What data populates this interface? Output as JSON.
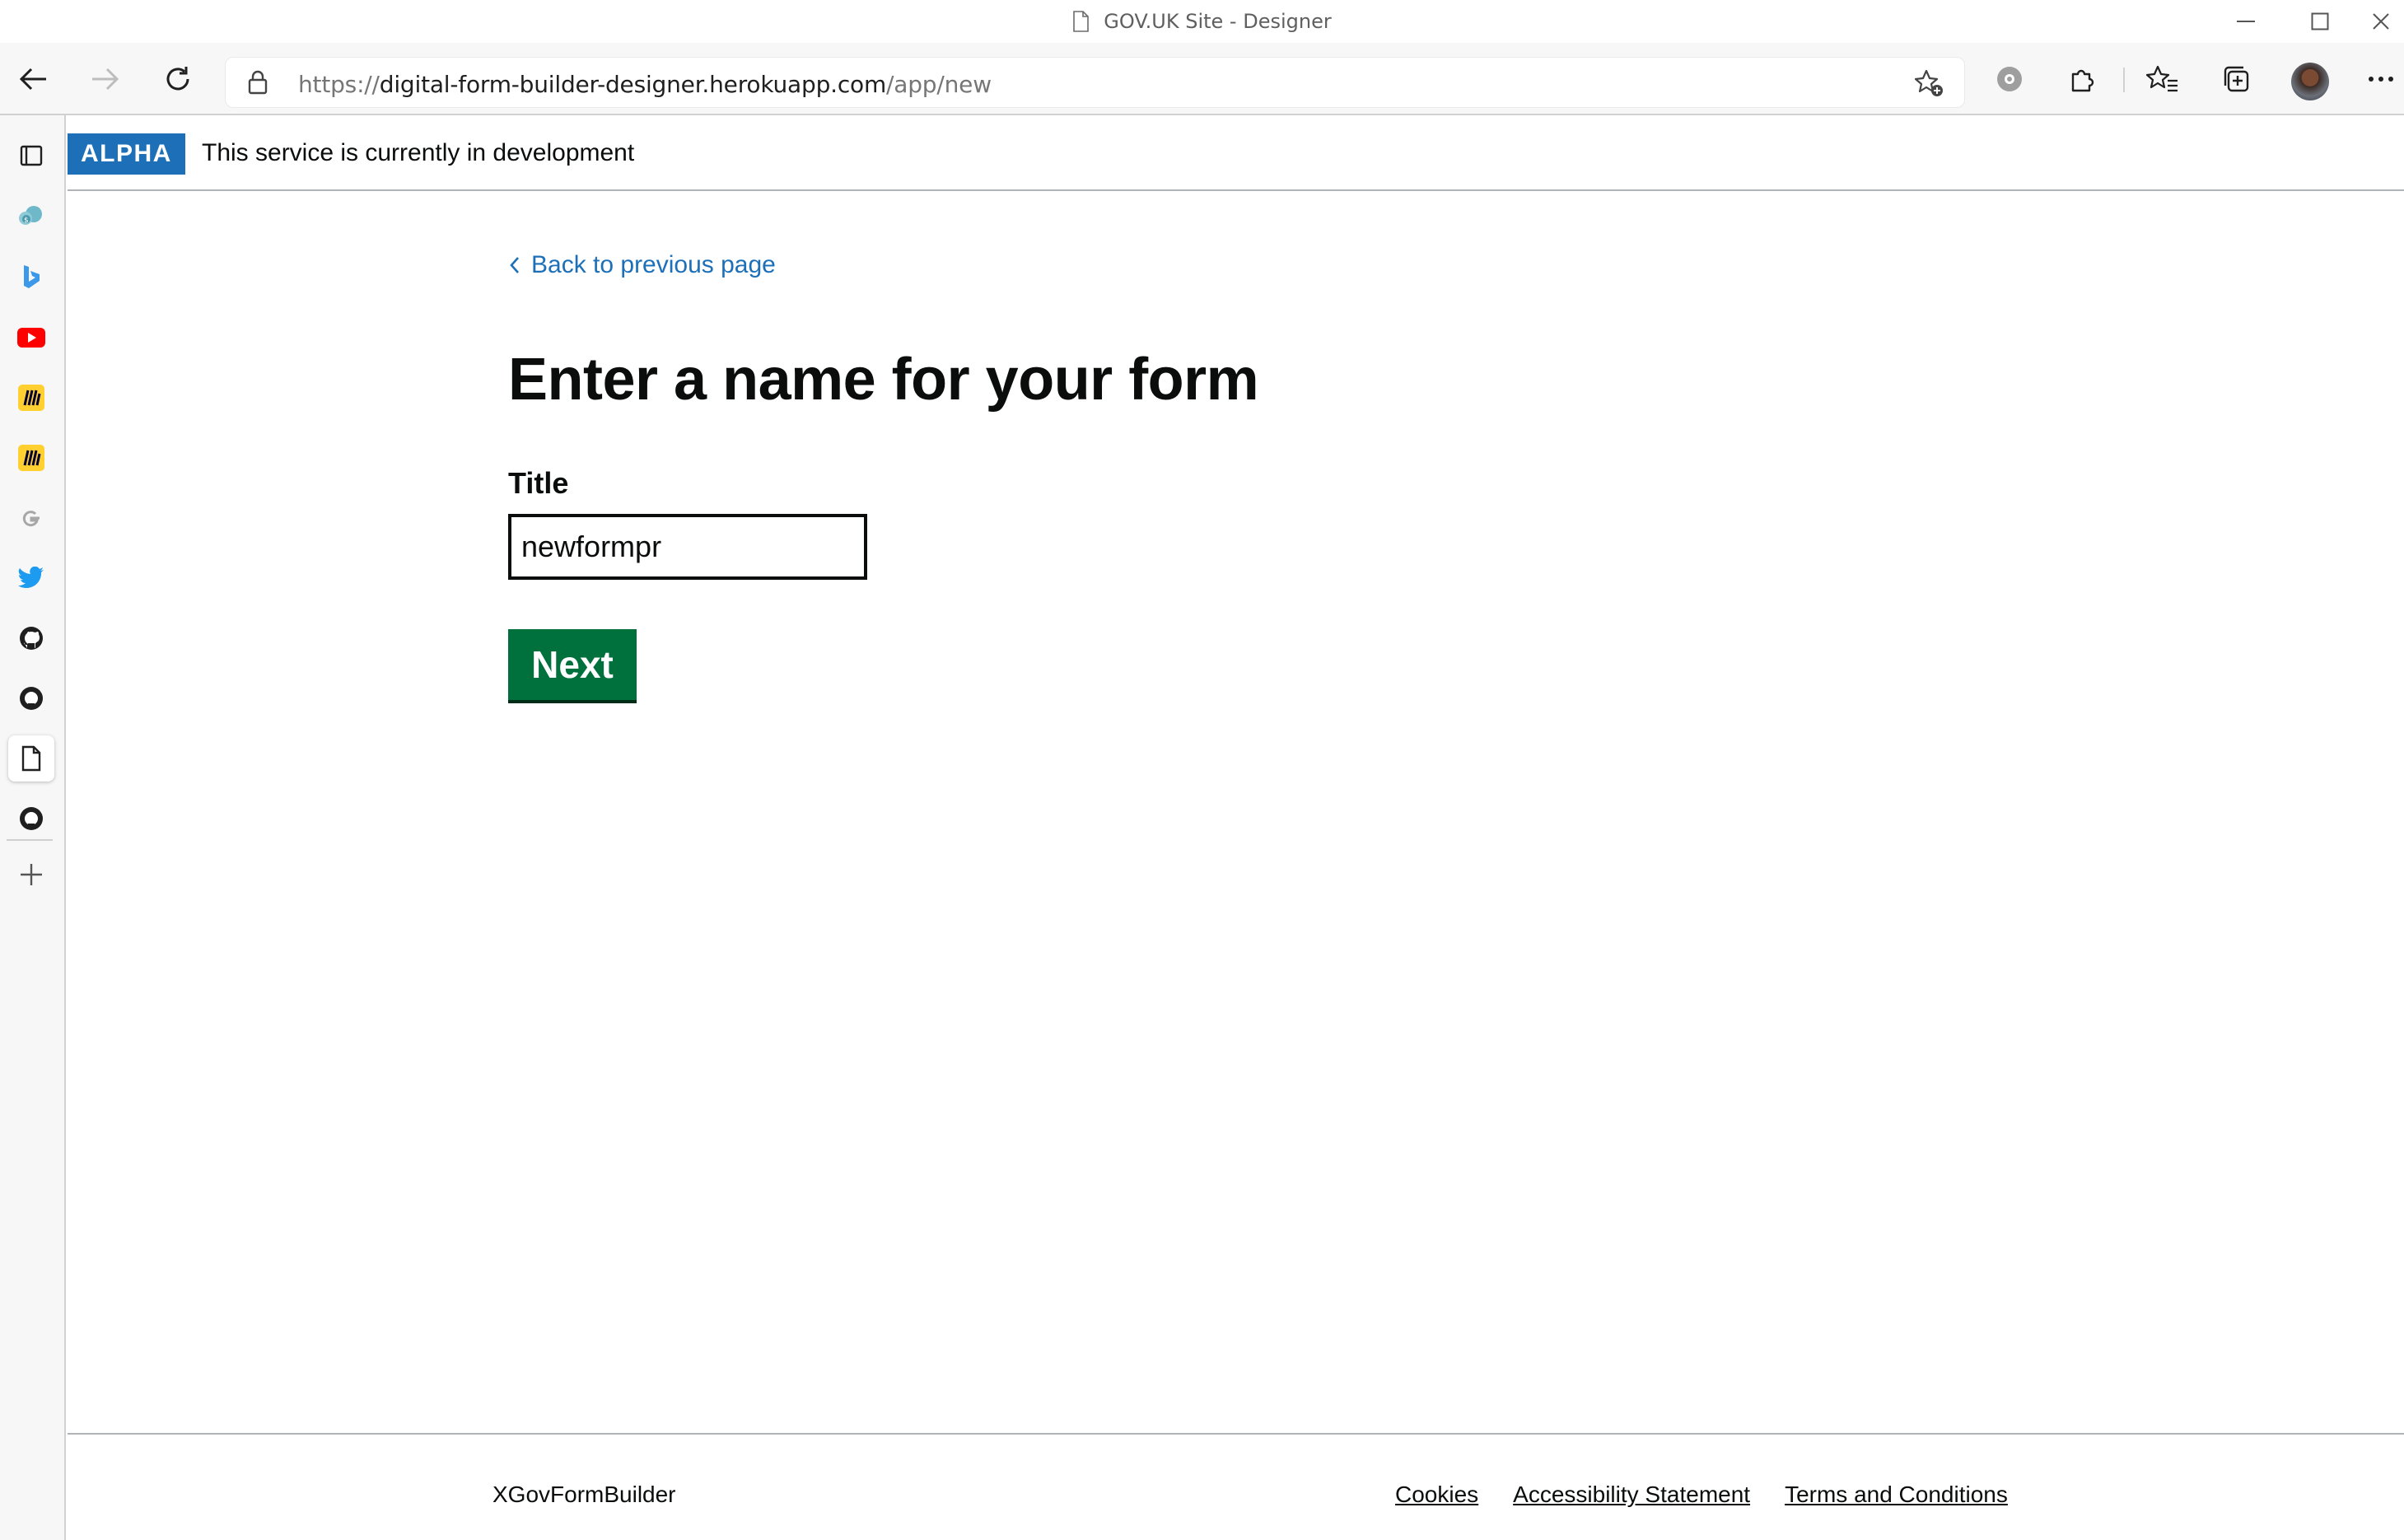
{
  "window": {
    "title": "GOV.UK Site - Designer"
  },
  "toolbar": {
    "url_scheme": "https://",
    "url_host": "digital-form-builder-designer.herokuapp.com",
    "url_path": "/app/new"
  },
  "sidebar": {
    "items": [
      {
        "name": "tab-actions-icon"
      },
      {
        "name": "cloud-money-icon"
      },
      {
        "name": "bing-icon"
      },
      {
        "name": "youtube-icon"
      },
      {
        "name": "miro-icon"
      },
      {
        "name": "miro-icon"
      },
      {
        "name": "google-icon"
      },
      {
        "name": "twitter-icon"
      },
      {
        "name": "github-icon"
      },
      {
        "name": "github-icon"
      },
      {
        "name": "document-icon"
      },
      {
        "name": "github-icon"
      },
      {
        "name": "add-icon"
      }
    ]
  },
  "banner": {
    "phase_tag": "ALPHA",
    "phase_text": "This service is currently in development"
  },
  "main": {
    "back_link": "Back to previous page",
    "heading": "Enter a name for your form",
    "title_label": "Title",
    "title_value": "newformpr",
    "next_button": "Next"
  },
  "footer": {
    "brand": "XGovFormBuilder",
    "links": [
      "Cookies",
      "Accessibility Statement",
      "Terms and Conditions"
    ]
  },
  "colors": {
    "govuk_blue": "#1d70b8",
    "govuk_green": "#00703c",
    "text": "#0b0c0c"
  }
}
